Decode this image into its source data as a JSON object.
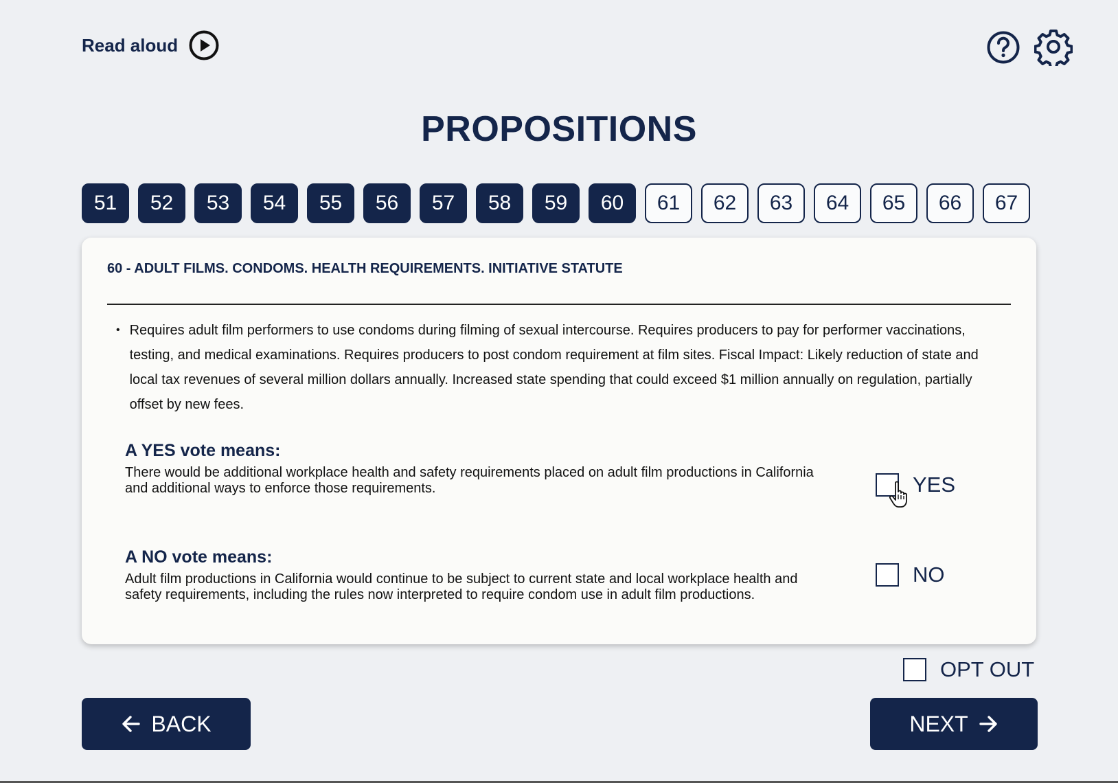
{
  "header": {
    "read_aloud_label": "Read aloud",
    "play_icon": "play-circle-icon",
    "help_icon": "help-circle-icon",
    "settings_icon": "gear-icon"
  },
  "page": {
    "title": "PROPOSITIONS"
  },
  "proposition_tabs": [
    {
      "label": "51",
      "state": "completed"
    },
    {
      "label": "52",
      "state": "completed"
    },
    {
      "label": "53",
      "state": "completed"
    },
    {
      "label": "54",
      "state": "completed"
    },
    {
      "label": "55",
      "state": "completed"
    },
    {
      "label": "56",
      "state": "completed"
    },
    {
      "label": "57",
      "state": "completed"
    },
    {
      "label": "58",
      "state": "completed"
    },
    {
      "label": "59",
      "state": "completed"
    },
    {
      "label": "60",
      "state": "current"
    },
    {
      "label": "61",
      "state": "pending"
    },
    {
      "label": "62",
      "state": "pending"
    },
    {
      "label": "63",
      "state": "pending"
    },
    {
      "label": "64",
      "state": "pending"
    },
    {
      "label": "65",
      "state": "pending"
    },
    {
      "label": "66",
      "state": "pending"
    },
    {
      "label": "67",
      "state": "pending"
    }
  ],
  "proposition": {
    "title": "60 - ADULT FILMS. CONDOMS. HEALTH REQUIREMENTS. INITIATIVE STATUTE",
    "summary": "Requires adult film performers to use condoms during filming of sexual intercourse. Requires producers to pay for performer vaccinations, testing, and medical examinations. Requires producers to post condom requirement at film sites. Fiscal Impact: Likely reduction of state and local tax revenues of several million dollars annually. Increased state spending that could exceed $1 million annually on regulation, partially offset by new fees.",
    "yes_heading": "A YES vote means:",
    "yes_text": "There would be additional workplace health and safety requirements placed on adult film productions in California and additional ways to enforce those requirements.",
    "no_heading": "A NO vote means:",
    "no_text": "Adult film productions in California would continue to be subject to current state and local workplace health and safety requirements, including the rules now interpreted to require condom use in adult film productions."
  },
  "choices": {
    "yes_label": "YES",
    "yes_checked": false,
    "no_label": "NO",
    "no_checked": false,
    "opt_out_label": "OPT OUT",
    "opt_out_checked": false
  },
  "navigation": {
    "back_label": "BACK",
    "next_label": "NEXT"
  },
  "colors": {
    "navy": "#14254a",
    "background": "#eef0f3",
    "card": "#fbfbf9"
  }
}
